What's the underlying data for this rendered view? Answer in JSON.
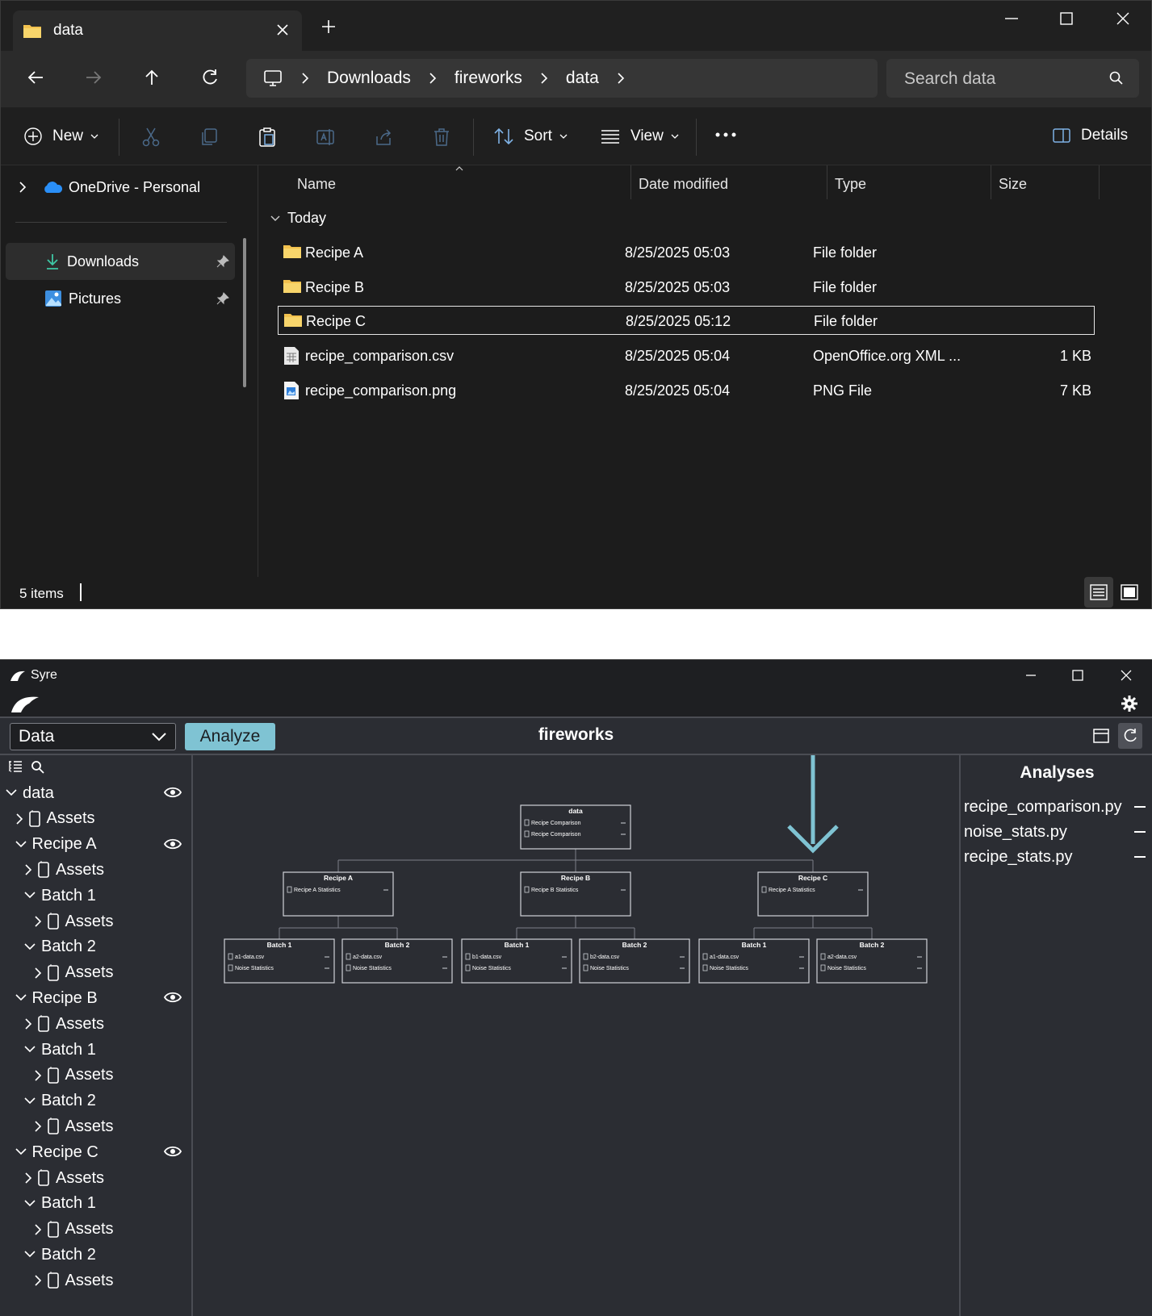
{
  "explorer": {
    "tab_title": "data",
    "breadcrumbs": [
      "Downloads",
      "fireworks",
      "data"
    ],
    "search_placeholder": "Search data",
    "toolbar": {
      "new_label": "New",
      "sort_label": "Sort",
      "view_label": "View",
      "details_label": "Details"
    },
    "nav": {
      "onedrive_label": "OneDrive - Personal",
      "downloads_label": "Downloads",
      "pictures_label": "Pictures"
    },
    "columns": {
      "name": "Name",
      "date": "Date modified",
      "type": "Type",
      "size": "Size"
    },
    "group_label": "Today",
    "files": [
      {
        "name": "Recipe A",
        "date": "8/25/2025 05:03",
        "type": "File folder",
        "size": "",
        "icon": "folder-icon"
      },
      {
        "name": "Recipe B",
        "date": "8/25/2025 05:03",
        "type": "File folder",
        "size": "",
        "icon": "folder-icon"
      },
      {
        "name": "Recipe C",
        "date": "8/25/2025 05:12",
        "type": "File folder",
        "size": "",
        "icon": "folder-icon"
      },
      {
        "name": "recipe_comparison.csv",
        "date": "8/25/2025 05:04",
        "type": "OpenOffice.org XML ...",
        "size": "1 KB",
        "icon": "spreadsheet-file-icon"
      },
      {
        "name": "recipe_comparison.png",
        "date": "8/25/2025 05:04",
        "type": "PNG File",
        "size": "7 KB",
        "icon": "image-file-icon"
      }
    ],
    "status_text": "5 items"
  },
  "syre": {
    "window_title": "Syre",
    "mode_select": "Data",
    "analyze_label": "Analyze",
    "project_title": "fireworks",
    "accent_color": "#7fc3d3",
    "tree": [
      {
        "label": "data",
        "asset": false,
        "expanded": true,
        "eye": true
      },
      {
        "label": "Assets",
        "asset": true,
        "expanded": false,
        "eye": false
      },
      {
        "label": "Recipe A",
        "asset": false,
        "expanded": true,
        "eye": true
      },
      {
        "label": "Assets",
        "asset": true,
        "expanded": false,
        "eye": false
      },
      {
        "label": "Batch 1",
        "asset": false,
        "expanded": true,
        "eye": false
      },
      {
        "label": "Assets",
        "asset": true,
        "expanded": false,
        "eye": false
      },
      {
        "label": "Batch 2",
        "asset": false,
        "expanded": true,
        "eye": false
      },
      {
        "label": "Assets",
        "asset": true,
        "expanded": false,
        "eye": false
      },
      {
        "label": "Recipe B",
        "asset": false,
        "expanded": true,
        "eye": true
      },
      {
        "label": "Assets",
        "asset": true,
        "expanded": false,
        "eye": false
      },
      {
        "label": "Batch 1",
        "asset": false,
        "expanded": true,
        "eye": false
      },
      {
        "label": "Assets",
        "asset": true,
        "expanded": false,
        "eye": false
      },
      {
        "label": "Batch 2",
        "asset": false,
        "expanded": true,
        "eye": false
      },
      {
        "label": "Assets",
        "asset": true,
        "expanded": false,
        "eye": false
      },
      {
        "label": "Recipe C",
        "asset": false,
        "expanded": true,
        "eye": true
      },
      {
        "label": "Assets",
        "asset": true,
        "expanded": false,
        "eye": false
      },
      {
        "label": "Batch 1",
        "asset": false,
        "expanded": true,
        "eye": false
      },
      {
        "label": "Assets",
        "asset": true,
        "expanded": false,
        "eye": false
      },
      {
        "label": "Batch 2",
        "asset": false,
        "expanded": true,
        "eye": false
      },
      {
        "label": "Assets",
        "asset": true,
        "expanded": false,
        "eye": false
      }
    ],
    "graph": {
      "root": {
        "title": "data",
        "items": [
          "Recipe Comparison",
          "Recipe Comparison"
        ]
      },
      "recipes": [
        {
          "title": "Recipe A",
          "items": [
            "Recipe A Statistics"
          ],
          "batches": [
            {
              "title": "Batch 1",
              "items": [
                "a1-data.csv",
                "Noise Statistics"
              ]
            },
            {
              "title": "Batch 2",
              "items": [
                "a2-data.csv",
                "Noise Statistics"
              ]
            }
          ]
        },
        {
          "title": "Recipe B",
          "items": [
            "Recipe B Statistics"
          ],
          "batches": [
            {
              "title": "Batch 1",
              "items": [
                "b1-data.csv",
                "Noise Statistics"
              ]
            },
            {
              "title": "Batch 2",
              "items": [
                "b2-data.csv",
                "Noise Statistics"
              ]
            }
          ]
        },
        {
          "title": "Recipe C",
          "items": [
            "Recipe A Statistics"
          ],
          "batches": [
            {
              "title": "Batch 1",
              "items": [
                "a1-data.csv",
                "Noise Statistics"
              ]
            },
            {
              "title": "Batch 2",
              "items": [
                "a2-data.csv",
                "Noise Statistics"
              ]
            }
          ]
        }
      ]
    },
    "analyses_title": "Analyses",
    "analyses": [
      "recipe_comparison.py",
      "noise_stats.py",
      "recipe_stats.py"
    ]
  }
}
